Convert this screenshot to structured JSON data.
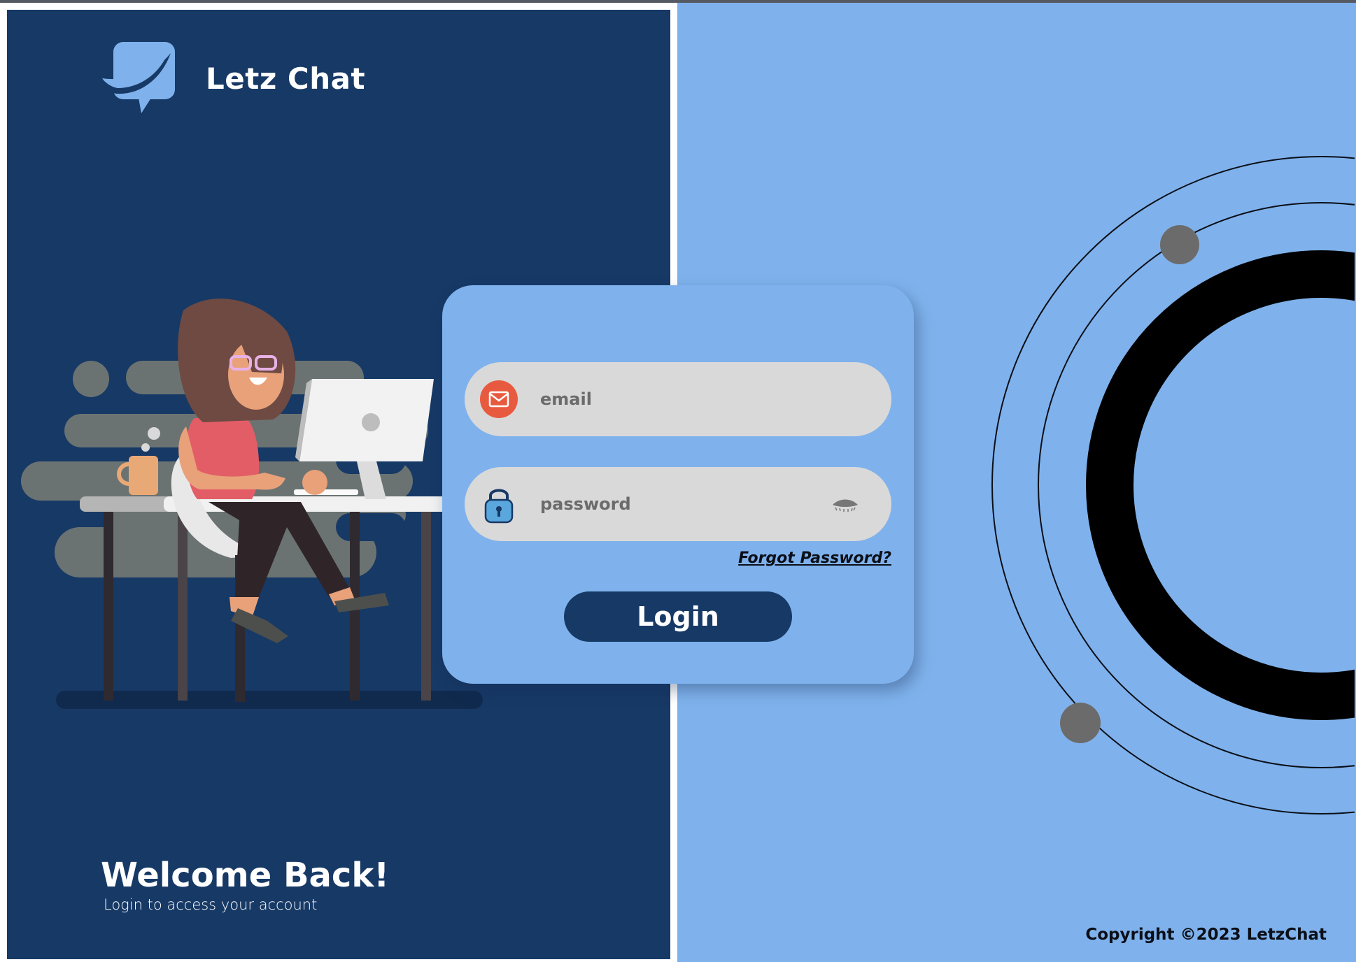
{
  "brand": {
    "name": "Letz Chat",
    "logo_icon": "chat-bubble-logo"
  },
  "welcome": {
    "title": "Welcome Back!",
    "subtitle": "Login to access your account"
  },
  "login_form": {
    "email": {
      "placeholder": "email",
      "value": "",
      "icon": "mail-icon"
    },
    "password": {
      "placeholder": "password",
      "value": "",
      "icon": "lock-icon",
      "toggle_icon": "eye-closed-icon"
    },
    "forgot_password_label": "Forgot Password?",
    "submit_label": "Login"
  },
  "footer": {
    "copyright": "Copyright ©2023 LetzChat"
  },
  "colors": {
    "navy": "#173966",
    "light_blue": "#7fb2ec",
    "field_gray": "#d9d9d9",
    "mail_red": "#e85a3f"
  }
}
